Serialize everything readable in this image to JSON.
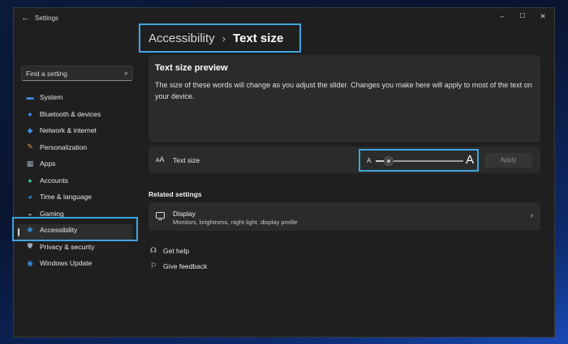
{
  "window": {
    "app_title": "Settings",
    "controls": {
      "minimize": "–",
      "maximize": "☐",
      "close": "✕"
    }
  },
  "breadcrumb": {
    "parent": "Accessibility",
    "separator": "›",
    "current": "Text size"
  },
  "search": {
    "placeholder": "Find a setting",
    "icon": "search-icon"
  },
  "nav": {
    "items": [
      {
        "label": "System",
        "icon": "system-icon",
        "icon_color": "#3b8ee0"
      },
      {
        "label": "Bluetooth & devices",
        "icon": "bluetooth-icon",
        "icon_color": "#3b8ee0"
      },
      {
        "label": "Network & internet",
        "icon": "wifi-icon",
        "icon_color": "#3b8ee0"
      },
      {
        "label": "Personalization",
        "icon": "brush-icon",
        "icon_color": "#e0924a"
      },
      {
        "label": "Apps",
        "icon": "apps-icon",
        "icon_color": "#9aa7b5"
      },
      {
        "label": "Accounts",
        "icon": "person-icon",
        "icon_color": "#38c08a"
      },
      {
        "label": "Time & language",
        "icon": "globe-clock-icon",
        "icon_color": "#3b8ee0"
      },
      {
        "label": "Gaming",
        "icon": "gamepad-icon",
        "icon_color": "#9aa7b5"
      },
      {
        "label": "Accessibility",
        "icon": "accessibility-icon",
        "icon_color": "#3b8ee0",
        "active": true
      },
      {
        "label": "Privacy & security",
        "icon": "shield-icon",
        "icon_color": "#9aa7b5"
      },
      {
        "label": "Windows Update",
        "icon": "update-icon",
        "icon_color": "#3b8ee0"
      }
    ]
  },
  "preview": {
    "title": "Text size preview",
    "body": "The size of these words will change as you adjust the slider. Changes you make here will apply to most of the text on your device."
  },
  "text_size": {
    "label": "Text size",
    "icon": "text-size-icon",
    "small_a": "A",
    "big_a": "A",
    "slider_value_fraction": 0.0,
    "apply_label": "Apply"
  },
  "related": {
    "header": "Related settings",
    "display": {
      "title": "Display",
      "subtitle": "Monitors, brightness, night light, display profile",
      "icon": "monitor-icon"
    }
  },
  "links": {
    "get_help": "Get help",
    "give_feedback": "Give feedback"
  },
  "colors": {
    "highlight": "#3fa4e0",
    "window_bg": "#1f1f1f",
    "card_bg": "#2b2b2b"
  }
}
